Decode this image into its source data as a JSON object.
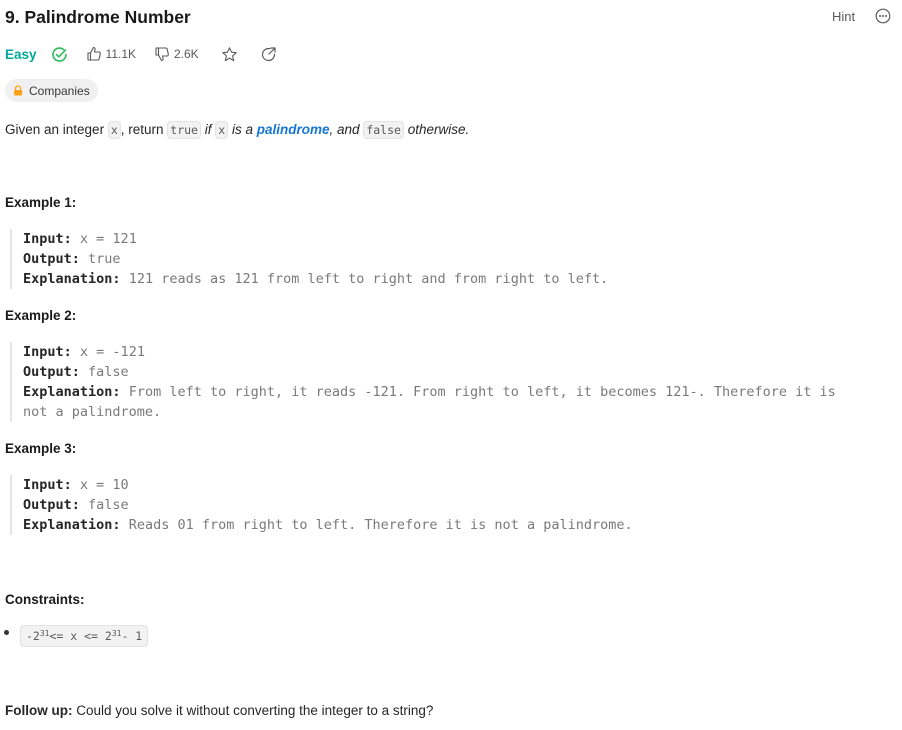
{
  "problem": {
    "title": "9. Palindrome Number",
    "hint_label": "Hint",
    "difficulty": "Easy",
    "likes": "11.1K",
    "dislikes": "2.6K",
    "companies_label": "Companies",
    "colors": {
      "easy": "#00a89c",
      "solved": "#2cbb5d",
      "link": "#1677d3",
      "lock": "#ffa116"
    }
  },
  "description": {
    "t1": "Given an integer ",
    "x": "x",
    "t2": ", return ",
    "true_code": "true",
    "if_word": "if",
    "is_a": "is a",
    "palindrome": "palindrome",
    "and_word": ", and",
    "false_code": "false",
    "otherwise": "otherwise."
  },
  "labels": {
    "input": "Input:",
    "output": "Output:",
    "explanation": "Explanation:"
  },
  "examples": [
    {
      "title": "Example 1:",
      "input": "x = 121",
      "output": "true",
      "explanation": "121 reads as 121 from left to right and from right to left."
    },
    {
      "title": "Example 2:",
      "input": "x = -121",
      "output": "false",
      "explanation": "From left to right, it reads -121. From right to left, it becomes 121-. Therefore it is",
      "explanation_cont": "not a palindrome."
    },
    {
      "title": "Example 3:",
      "input": "x = 10",
      "output": "false",
      "explanation": "Reads 01 from right to left. Therefore it is not a palindrome."
    }
  ],
  "constraints": {
    "title": "Constraints:",
    "c_neg": "-2",
    "c_exp1": "31",
    "c_mid": " <= x <= 2",
    "c_exp2": "31",
    "c_end": " - 1"
  },
  "follow_up": {
    "label": "Follow up:",
    "text": " Could you solve it without converting the integer to a string?"
  }
}
